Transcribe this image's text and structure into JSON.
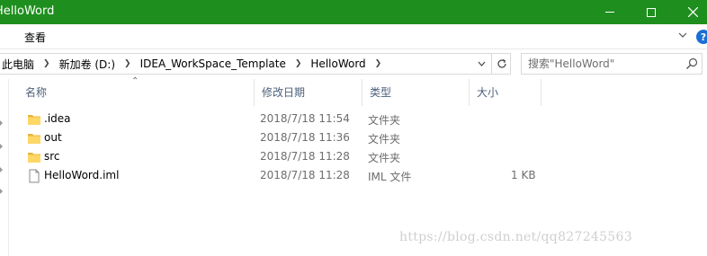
{
  "window": {
    "title": "HelloWord",
    "colors": {
      "titlebar": "#1e8f1e",
      "help": "#1a6fd4"
    }
  },
  "ribbon": {
    "tab_view": "查看"
  },
  "address": {
    "crumbs": [
      "此电脑",
      "新加卷 (D:)",
      "IDEA_WorkSpace_Template",
      "HelloWord"
    ]
  },
  "search": {
    "placeholder": "搜索\"HelloWord\""
  },
  "columns": {
    "name": "名称",
    "date": "修改日期",
    "type": "类型",
    "size": "大小"
  },
  "files": [
    {
      "name": ".idea",
      "date": "2018/7/18 11:54",
      "type": "文件夹",
      "size": "",
      "icon": "folder-icon"
    },
    {
      "name": "out",
      "date": "2018/7/18 11:36",
      "type": "文件夹",
      "size": "",
      "icon": "folder-icon"
    },
    {
      "name": "src",
      "date": "2018/7/18 11:28",
      "type": "文件夹",
      "size": "",
      "icon": "folder-icon"
    },
    {
      "name": "HelloWord.iml",
      "date": "2018/7/18 11:28",
      "type": "IML 文件",
      "size": "1 KB",
      "icon": "file-icon"
    }
  ],
  "watermark": "https://blog.csdn.net/qq827245563"
}
